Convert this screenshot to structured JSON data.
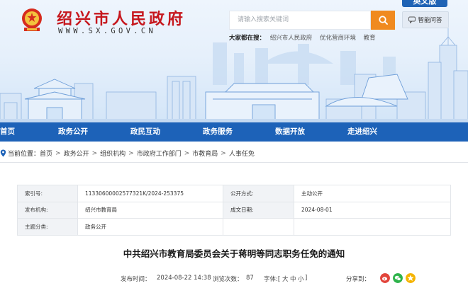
{
  "header": {
    "site_title": "绍兴市人民政府",
    "site_url": "WWW.SX.GOV.CN",
    "lang_tab": "英文版",
    "elder_button": "智能问答",
    "search_placeholder": "请输入搜索关键词",
    "hot_search_label": "大家都在搜：",
    "hot_search": [
      "绍兴市人民政府",
      "优化营商环境",
      "教育"
    ]
  },
  "nav": {
    "items": [
      "首页",
      "政务公开",
      "政民互动",
      "政务服务",
      "数据开放",
      "走进绍兴"
    ]
  },
  "breadcrumb": {
    "label": "当前位置：",
    "items": [
      "首页",
      "政务公开",
      "组织机构",
      "市政府工作部门",
      "市教育局",
      "人事任免"
    ]
  },
  "info": {
    "rows": [
      {
        "k1": "索引号:",
        "v1": "11330600002577321K/2024-253375",
        "k2": "公开方式:",
        "v2": "主动公开"
      },
      {
        "k1": "发布机构:",
        "v1": "绍兴市教育局",
        "k2": "成文日期:",
        "v2": "2024-08-01"
      },
      {
        "k1": "主题分类:",
        "v1": "政务公开",
        "k2": "",
        "v2": ""
      }
    ]
  },
  "article": {
    "title": "中共绍兴市教育局委员会关于蒋明等同志职务任免的通知",
    "date_label": "发布时间：",
    "date": "2024-08-22 14:38",
    "views_label": "浏览次数：",
    "views": "87",
    "font_label": "字体:[",
    "font_big": "大",
    "font_mid": "中",
    "font_small": "小",
    "font_end": "]",
    "share_label": "分享到："
  },
  "colors": {
    "primary_blue": "#1d62b8",
    "brand_red": "#c6171d",
    "search_orange": "#f08a1f"
  }
}
